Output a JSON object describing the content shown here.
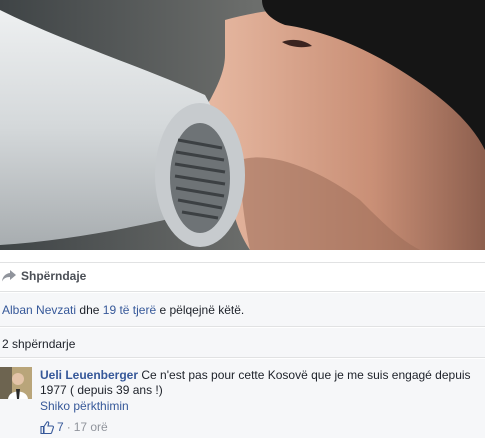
{
  "post": {
    "share_action_label": "Shpërndaje",
    "likes": {
      "first_liker": "Alban Nevzati",
      "connector": "dhe",
      "others_link": "19 të tjerë",
      "suffix": "e pëlqejnë këtë."
    },
    "shares_label": "2 shpërndarje"
  },
  "comment": {
    "author": "Ueli Leuenberger",
    "text": "Ce n'est pas pour cette Kosovë que je me suis engagé depuis 1977 ( depuis 39 ans !)",
    "translate_label": "Shiko përkthimin",
    "like_count": "7",
    "separator": "·",
    "time": "17 orë"
  },
  "colors": {
    "link": "#365899",
    "meta": "#90949c",
    "divider": "#e1e2e3"
  },
  "icons": [
    "share-icon",
    "like-thumb-icon"
  ]
}
